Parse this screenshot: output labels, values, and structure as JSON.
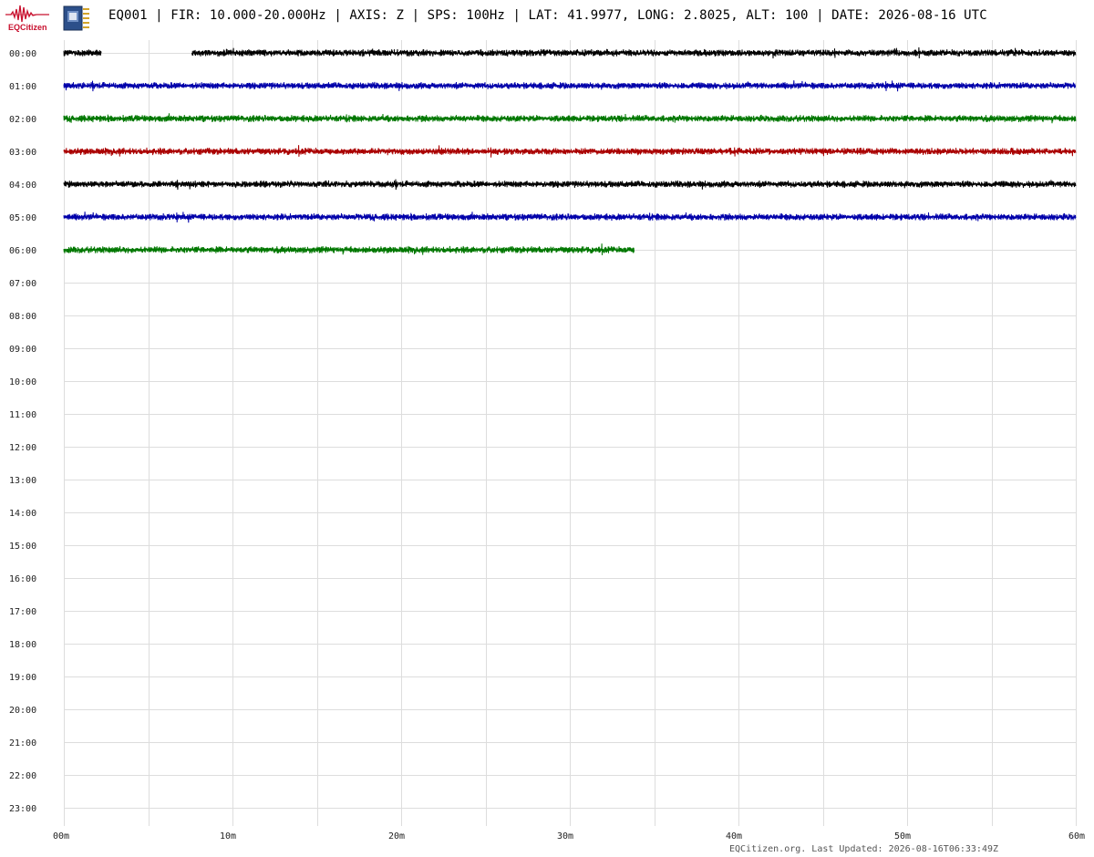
{
  "header": {
    "logo_text": "EQCitizen",
    "title": "EQ001 | FIR: 10.000-20.000Hz | AXIS: Z | SPS: 100Hz | LAT: 41.9977, LONG: 2.8025, ALT: 100 | DATE: 2026-08-16 UTC"
  },
  "footer": {
    "text": "EQCitizen.org. Last Updated: 2026-08-16T06:33:49Z"
  },
  "chart_data": {
    "type": "line",
    "title": "EQ001 | FIR: 10.000-20.000Hz | AXIS: Z | SPS: 100Hz | LAT: 41.9977, LONG: 2.8025, ALT: 100 | DATE: 2026-08-16 UTC",
    "xlim": [
      0,
      60
    ],
    "x_ticks": [
      {
        "value": 0,
        "label": "00m"
      },
      {
        "value": 10,
        "label": "10m"
      },
      {
        "value": 20,
        "label": "20m"
      },
      {
        "value": 30,
        "label": "30m"
      },
      {
        "value": 40,
        "label": "40m"
      },
      {
        "value": 50,
        "label": "50m"
      },
      {
        "value": 60,
        "label": "60m"
      }
    ],
    "x_grid_step": 5,
    "rows": [
      "00:00",
      "01:00",
      "02:00",
      "03:00",
      "04:00",
      "05:00",
      "06:00",
      "07:00",
      "08:00",
      "09:00",
      "10:00",
      "11:00",
      "12:00",
      "13:00",
      "14:00",
      "15:00",
      "16:00",
      "17:00",
      "18:00",
      "19:00",
      "20:00",
      "21:00",
      "22:00",
      "23:00"
    ],
    "grid": true,
    "traces": [
      {
        "row": "00:00",
        "color": "#000000",
        "segments": [
          [
            0,
            2.2
          ],
          [
            7.6,
            60
          ]
        ]
      },
      {
        "row": "01:00",
        "color": "#0000aa",
        "segments": [
          [
            0,
            60
          ]
        ]
      },
      {
        "row": "02:00",
        "color": "#007700",
        "segments": [
          [
            0,
            60
          ]
        ]
      },
      {
        "row": "03:00",
        "color": "#aa0000",
        "segments": [
          [
            0,
            60
          ]
        ]
      },
      {
        "row": "04:00",
        "color": "#000000",
        "segments": [
          [
            0,
            60
          ]
        ]
      },
      {
        "row": "05:00",
        "color": "#0000aa",
        "segments": [
          [
            0,
            60
          ]
        ]
      },
      {
        "row": "06:00",
        "color": "#007700",
        "segments": [
          [
            0,
            33.8
          ]
        ]
      }
    ]
  }
}
